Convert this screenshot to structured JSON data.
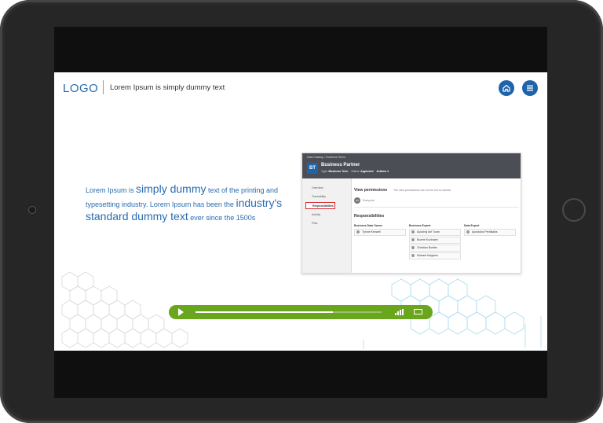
{
  "header": {
    "logo": "LOGO",
    "subtitle": "Lorem Ipsum is simply dummy text",
    "home_icon": "home-icon",
    "menu_icon": "hamburger-menu-icon"
  },
  "lead": {
    "p1": "Lorem Ipsum is ",
    "p2": "simply dummy",
    "p3": " text of the printing and typesetting industry. Lorem Ipsum has been the ",
    "p4": "industry's standard dummy text",
    "p5": " ever since the 1500s"
  },
  "screenshot": {
    "breadcrumb": "Data Catalog  >  Business Terms",
    "badge": "BT",
    "title": "Business Partner",
    "meta": {
      "type_label": "Type:",
      "type_value": "Business Term",
      "status_label": "Status:",
      "status_value": "Approved",
      "actions": "Actions ▾"
    },
    "sidebar": [
      "Overview",
      "Traceability",
      "Responsibilities",
      "Activity",
      "Files"
    ],
    "view_permissions": {
      "title": "View permissions",
      "note": "The view permissions can not be set on assets.",
      "avatar": "EV",
      "value": "Everyone"
    },
    "responsibilities": {
      "title": "Responsibilities",
      "columns": [
        {
          "head": "Business Data Owner",
          "people": [
            "Tyrone Keswell"
          ]
        },
        {
          "head": "Business Expert",
          "people": [
            "Aylozhaj Ant Turan",
            "Bozent Kozlowen",
            "Christian Boelter",
            "Michael Kalgaren"
          ]
        },
        {
          "head": "Data Expert",
          "people": [
            "Apostolos Perdikakis"
          ]
        }
      ]
    }
  },
  "player": {
    "progress": 0.74,
    "play_icon": "play-icon",
    "volume_icon": "volume-icon",
    "fullscreen_icon": "fullscreen-icon"
  }
}
